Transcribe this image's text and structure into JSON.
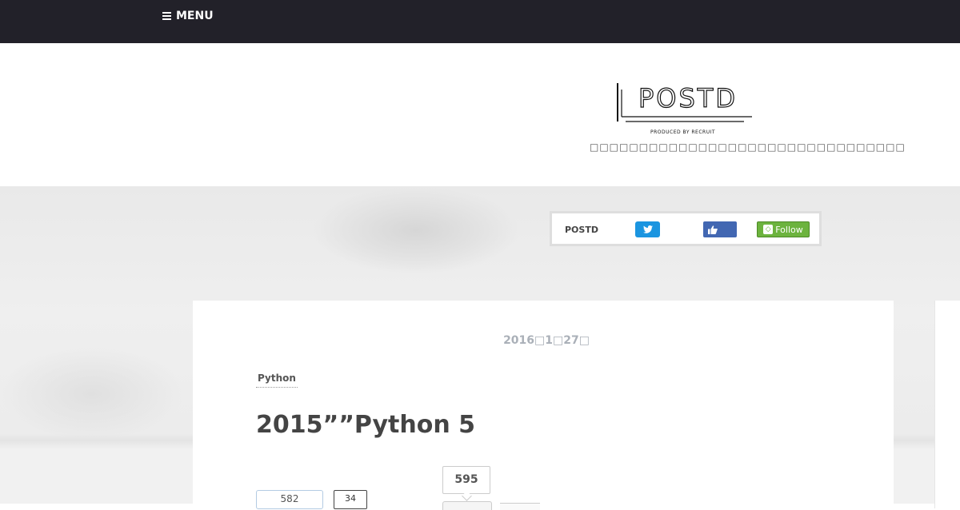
{
  "nav": {
    "menu_label": "MENU"
  },
  "header": {
    "logo_text": "POSTD",
    "logo_subtext": "PRODUCED BY RECRUIT",
    "tagline": "□□□□□□□□□□□□□□□□□□□□□□□□□□□□□□□□"
  },
  "social": {
    "label": "POSTD",
    "follow_label": "Follow"
  },
  "article": {
    "date": "2016□1□27□",
    "category": "Python",
    "title": "2015””Python 5"
  },
  "share": {
    "hatena_count": "582",
    "pocket_count": "34",
    "bubble_count": "595"
  },
  "colors": {
    "topbar": "#222129",
    "twitter": "#1b95e0",
    "facebook": "#4267b2",
    "feedly": "#6cb33e"
  }
}
